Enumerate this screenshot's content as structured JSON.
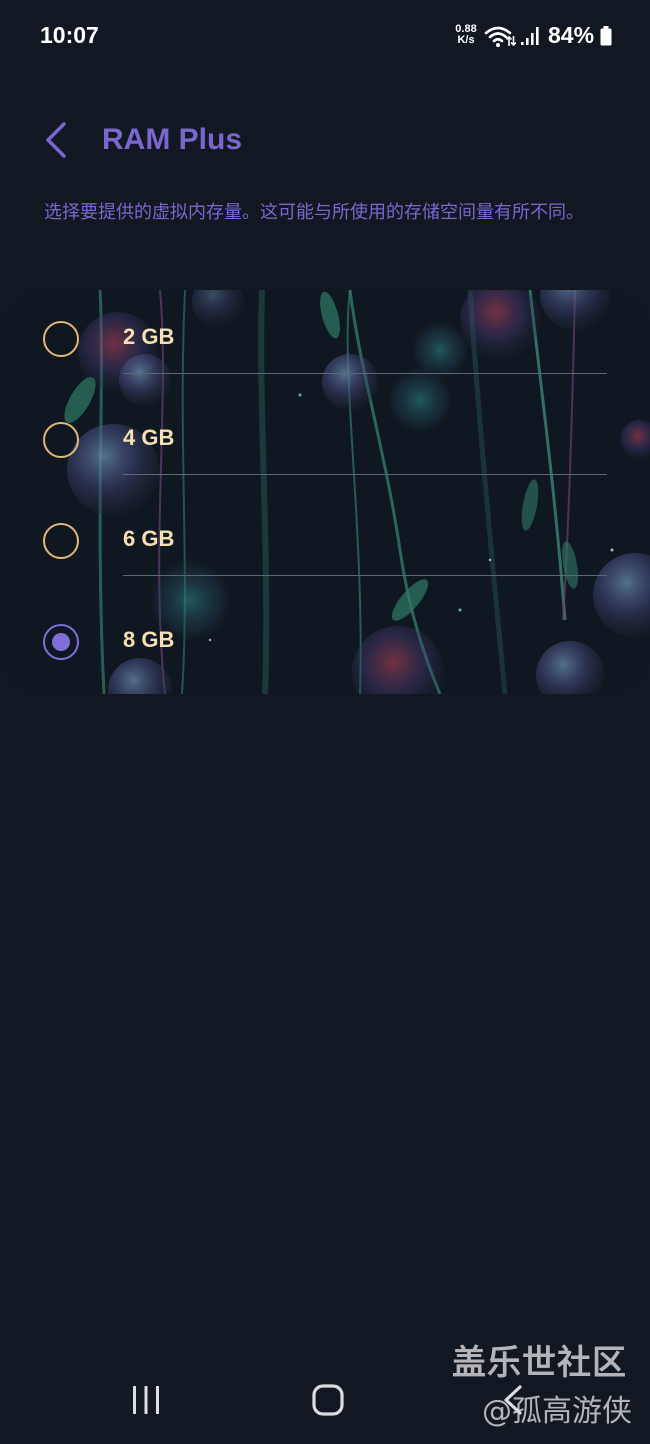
{
  "status_bar": {
    "time": "10:07",
    "net_speed_value": "0.88",
    "net_speed_unit": "K/s",
    "battery": "84%",
    "icons": [
      "wifi-icon",
      "signal-icon",
      "battery-icon"
    ]
  },
  "header": {
    "title": "RAM Plus",
    "back_icon": "chevron-left-icon"
  },
  "description": "选择要提供的虚拟内存量。这可能与所使用的存储空间量有所不同。",
  "options": [
    {
      "label": "2 GB",
      "selected": false
    },
    {
      "label": "4 GB",
      "selected": false
    },
    {
      "label": "6 GB",
      "selected": false
    },
    {
      "label": "8 GB",
      "selected": true
    }
  ],
  "watermark": {
    "line1": "盖乐世社区",
    "line2": "@孤高游侠"
  },
  "nav_bar": {
    "icons": [
      "recent-apps-icon",
      "home-icon",
      "back-icon"
    ]
  },
  "colors": {
    "background": "#121821",
    "accent": "#7b66cf",
    "radio_unselected": "#e3b874",
    "option_text": "#f6dfb2"
  }
}
